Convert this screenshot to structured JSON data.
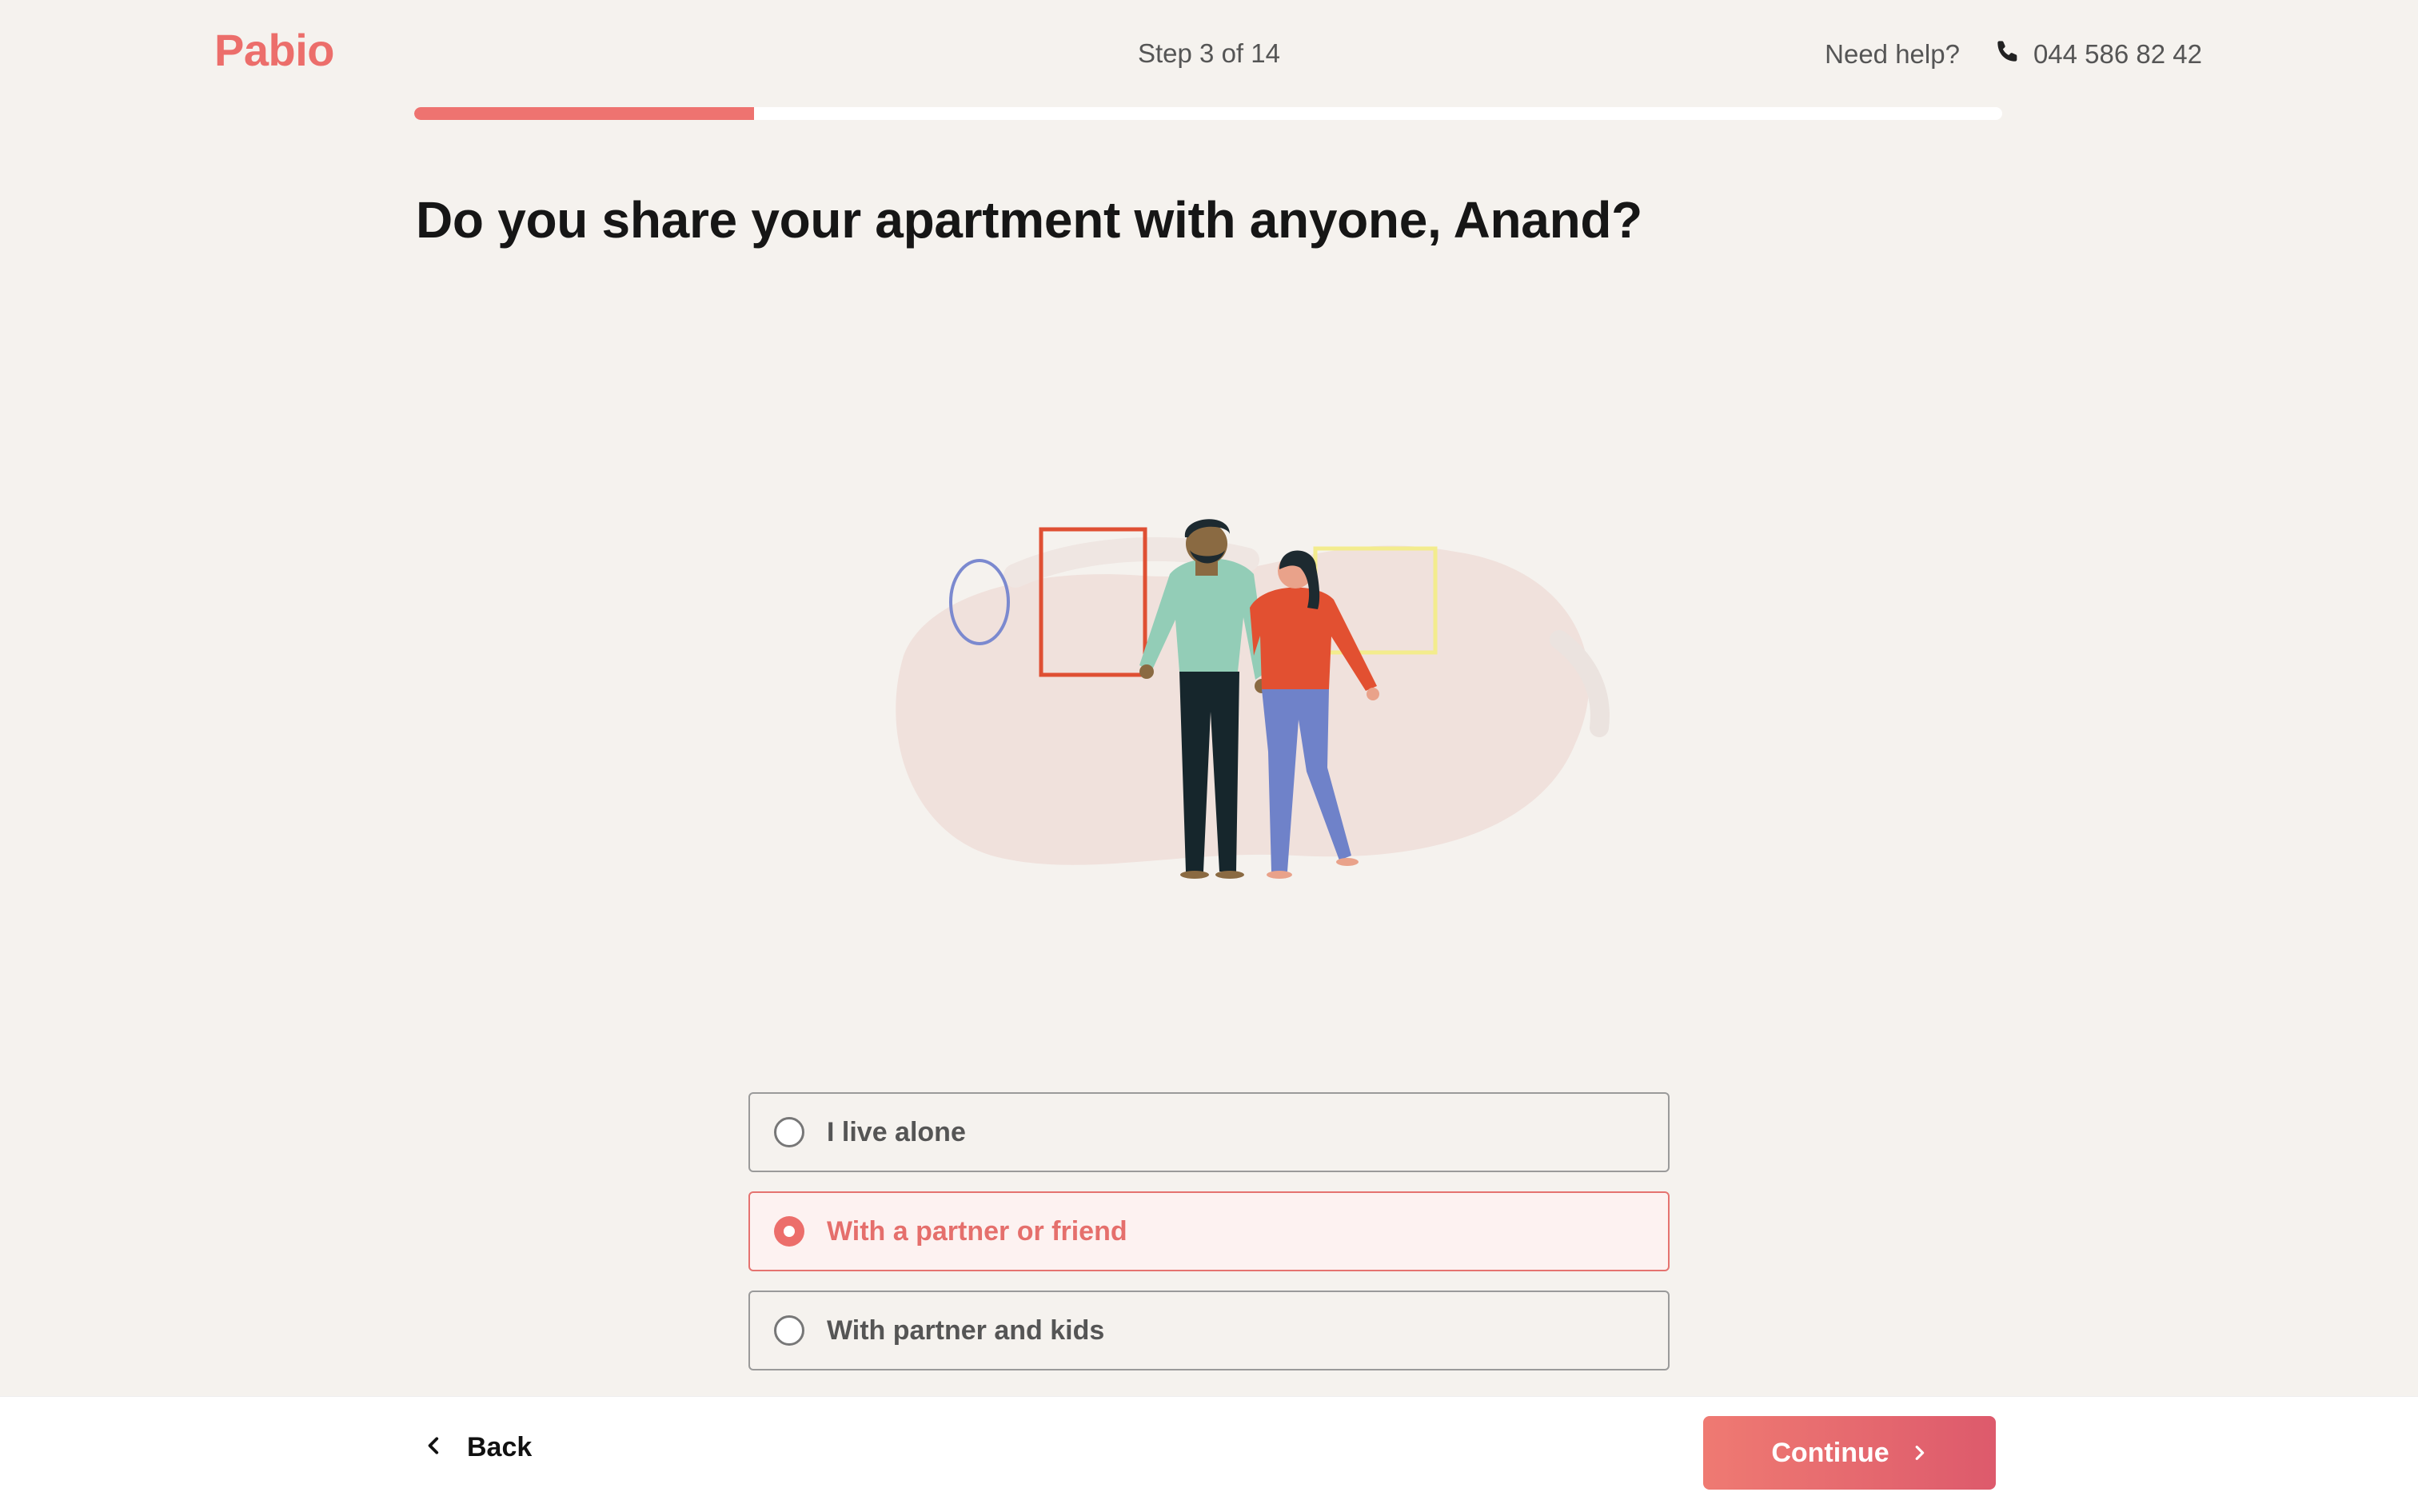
{
  "header": {
    "logo": "Pabio",
    "step_text": "Step 3 of 14",
    "help_text": "Need help?",
    "phone_number": "044 586 82 42",
    "progress_fraction": 0.214
  },
  "question": "Do you share your apartment with anyone, Anand?",
  "options": [
    {
      "label": "I live alone",
      "selected": false
    },
    {
      "label": "With a partner or friend",
      "selected": true
    },
    {
      "label": "With partner and kids",
      "selected": false
    }
  ],
  "footer": {
    "back_label": "Back",
    "continue_label": "Continue"
  },
  "colors": {
    "accent": "#ec6e6b",
    "background": "#f5f2ee"
  }
}
